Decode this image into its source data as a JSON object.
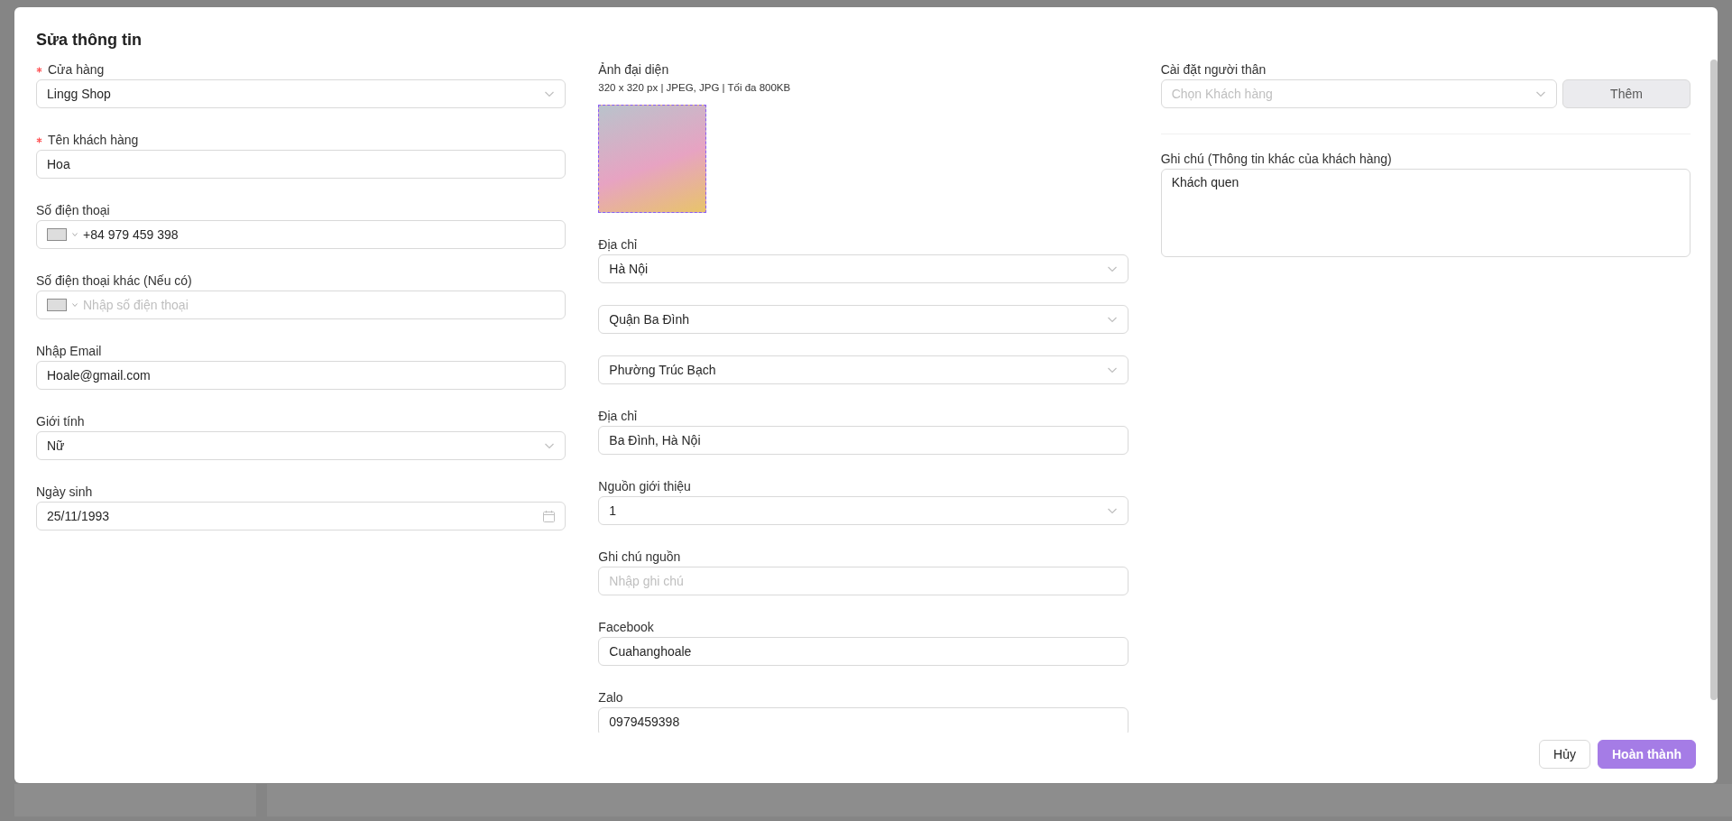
{
  "dialog": {
    "title": "Sửa thông tin"
  },
  "columns": [
    [
      {
        "kind": "select",
        "label": "Cửa hàng",
        "required": true,
        "value": "Lingg Shop"
      },
      {
        "kind": "input",
        "label": "Tên khách hàng",
        "required": true,
        "value": "Hoa"
      },
      {
        "kind": "phone",
        "label": "Số điện thoại",
        "required": false,
        "value": "+84 979 459 398"
      },
      {
        "kind": "phone",
        "label": "Số điện thoại khác (Nếu có)",
        "required": false,
        "placeholder": "Nhập số điện thoại"
      },
      {
        "kind": "input",
        "label": "Nhập Email",
        "required": false,
        "value": "Hoale@gmail.com"
      },
      {
        "kind": "select",
        "label": "Giới tính",
        "required": false,
        "value": "Nữ"
      },
      {
        "kind": "date",
        "label": "Ngày sinh",
        "required": false,
        "value": "25/11/1993"
      }
    ],
    [
      {
        "kind": "image",
        "label": "Ảnh đại diện",
        "required": false,
        "hint": "320 x 320 px | JPEG, JPG | Tối đa 800KB"
      },
      {
        "kind": "select",
        "label": "Địa chỉ",
        "required": false,
        "value": "Hà Nội"
      },
      {
        "kind": "select",
        "value": "Quận Ba Đình"
      },
      {
        "kind": "select",
        "value": "Phường Trúc Bạch"
      },
      {
        "kind": "input",
        "label": "Địa chỉ",
        "required": false,
        "value": "Ba Đình, Hà Nội"
      },
      {
        "kind": "select",
        "label": "Nguồn giới thiệu",
        "required": false,
        "value": "1"
      },
      {
        "kind": "input",
        "label": "Ghi chú nguồn",
        "required": false,
        "placeholder": "Nhập ghi chú"
      },
      {
        "kind": "input",
        "label": "Facebook",
        "required": false,
        "value": "Cuahanghoale"
      },
      {
        "kind": "input",
        "label": "Zalo",
        "required": false,
        "value": "0979459398"
      }
    ],
    [
      {
        "kind": "relative",
        "label": "Cài đặt người thân",
        "required": false,
        "placeholder": "Chọn Khách hàng",
        "button": "Thêm"
      },
      {
        "kind": "textarea",
        "label": "Ghi chú (Thông tin khác của khách hàng)",
        "required": false,
        "value": "Khách quen"
      }
    ]
  ],
  "footer": {
    "buttons": [
      {
        "label": "Hủy",
        "kind": "secondary"
      },
      {
        "label": "Hoàn thành",
        "kind": "primary"
      }
    ]
  }
}
